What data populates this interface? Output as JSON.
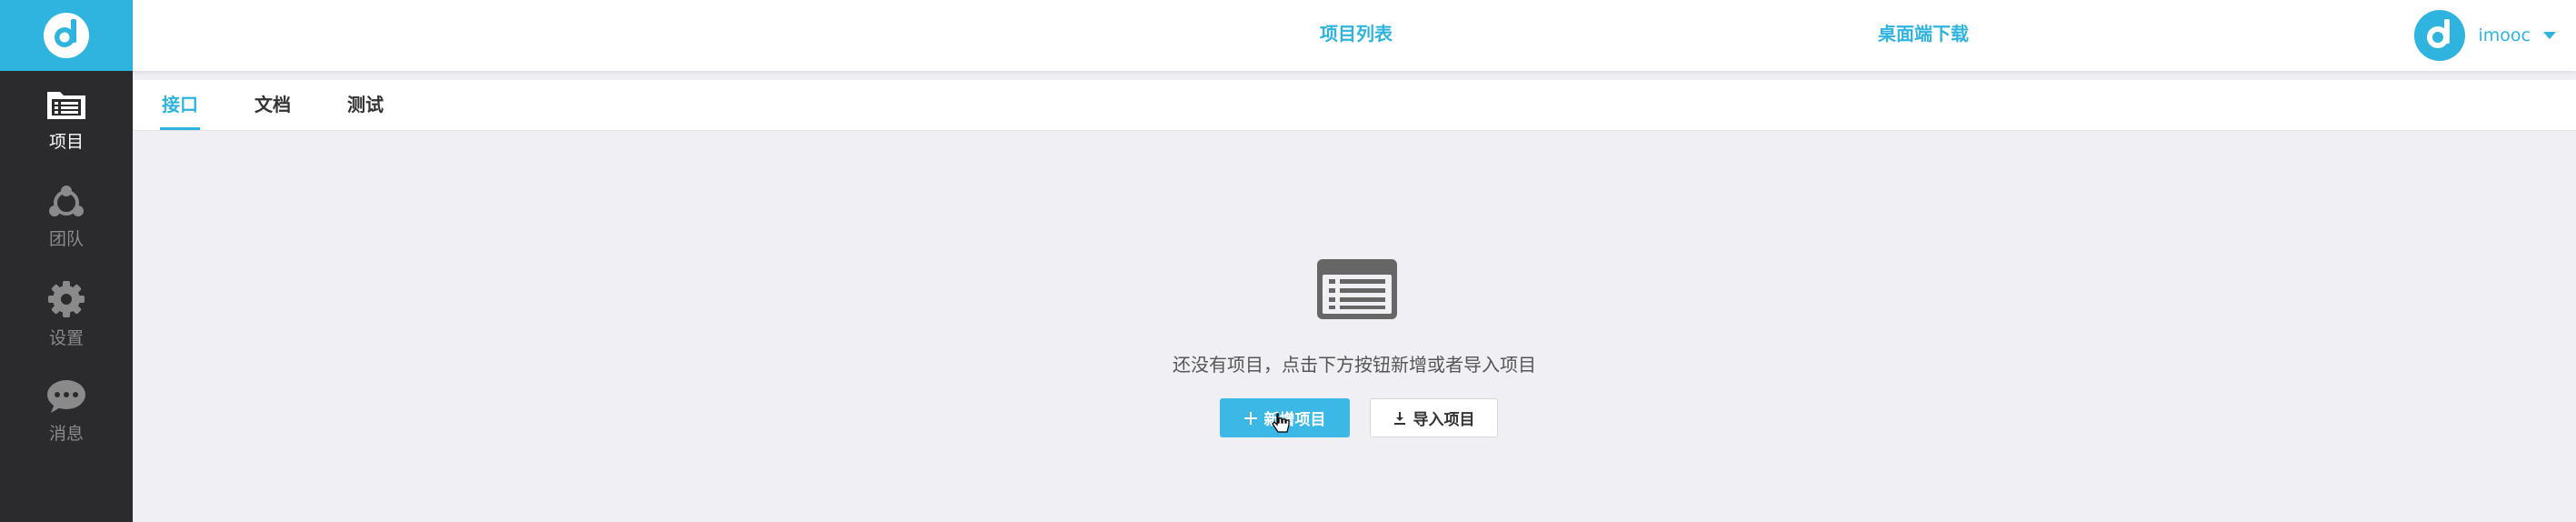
{
  "sidebar": {
    "items": [
      {
        "label": "项目",
        "icon": "project-list-icon",
        "active": true
      },
      {
        "label": "团队",
        "icon": "team-icon",
        "active": false
      },
      {
        "label": "设置",
        "icon": "gear-icon",
        "active": false
      },
      {
        "label": "消息",
        "icon": "chat-bubble-icon",
        "active": false
      }
    ]
  },
  "header": {
    "links": [
      "项目列表",
      "桌面端下载"
    ],
    "user": {
      "name": "imooc"
    }
  },
  "tabs": [
    {
      "label": "接口",
      "active": true
    },
    {
      "label": "文档",
      "active": false
    },
    {
      "label": "测试",
      "active": false
    }
  ],
  "empty_state": {
    "message": "还没有项目，点击下方按钮新增或者导入项目",
    "new_button": "新增项目",
    "import_button": "导入项目"
  },
  "colors": {
    "accent": "#2fb4e0",
    "sidebar_bg": "#2b2b2e",
    "content_bg": "#f0eff4"
  }
}
